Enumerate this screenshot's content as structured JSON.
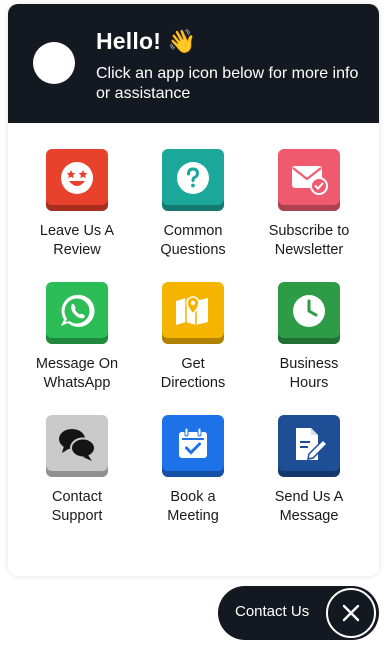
{
  "header": {
    "greeting": "Hello! 👋",
    "subtitle": "Click an app icon below for more info or assistance"
  },
  "apps": [
    {
      "label_line1": "Leave Us A",
      "label_line2": "Review",
      "icon": "star-face-icon",
      "color": "#E8412C"
    },
    {
      "label_line1": "Common",
      "label_line2": "Questions",
      "icon": "question-icon",
      "color": "#1BA89A"
    },
    {
      "label_line1": "Subscribe to",
      "label_line2": "Newsletter",
      "icon": "envelope-check-icon",
      "color": "#EF5A6E"
    },
    {
      "label_line1": "Message On",
      "label_line2": "WhatsApp",
      "icon": "whatsapp-icon",
      "color": "#2DBD56"
    },
    {
      "label_line1": "Get",
      "label_line2": "Directions",
      "icon": "map-pin-icon",
      "color": "#F4B400"
    },
    {
      "label_line1": "Business",
      "label_line2": "Hours",
      "icon": "clock-icon",
      "color": "#2E9B46"
    },
    {
      "label_line1": "Contact",
      "label_line2": "Support",
      "icon": "chat-bubbles-icon",
      "color": "#C9C9C9"
    },
    {
      "label_line1": "Book a",
      "label_line2": "Meeting",
      "icon": "calendar-check-icon",
      "color": "#1E72E8"
    },
    {
      "label_line1": "Send Us A",
      "label_line2": "Message",
      "icon": "document-pen-icon",
      "color": "#1D4E96"
    }
  ],
  "launcher": {
    "label": "Contact Us"
  }
}
